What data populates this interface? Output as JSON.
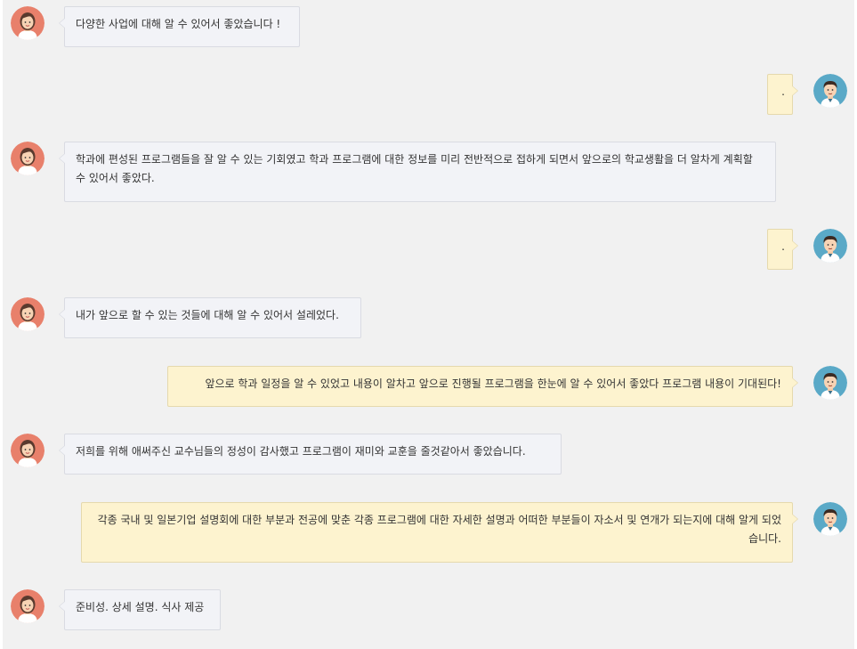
{
  "colors": {
    "left_bubble_bg": "#f2f3f7",
    "right_bubble_bg": "#fdf3cf",
    "chat_bg": "#f1f1f1",
    "female_avatar_bg": "#e8806b",
    "male_avatar_bg": "#5aa9c7"
  },
  "messages": [
    {
      "side": "left",
      "avatar": "female-avatar-icon",
      "text": "다양한 사업에 대해 알 수 있어서 좋았습니다 !"
    },
    {
      "side": "right",
      "avatar": "male-avatar-icon",
      "text": "."
    },
    {
      "side": "left",
      "avatar": "female-avatar-icon",
      "text": "학과에 편성된 프로그램들을 잘 알 수 있는 기회였고 학과 프로그램에 대한 정보를 미리 전반적으로 접하게 되면서 앞으로의 학교생활을 더 알차게 계획할 수 있어서 좋았다."
    },
    {
      "side": "right",
      "avatar": "male-avatar-icon",
      "text": "."
    },
    {
      "side": "left",
      "avatar": "female-avatar-icon",
      "text": "내가 앞으로 할 수 있는 것들에 대해 알 수 있어서 설레었다."
    },
    {
      "side": "right",
      "avatar": "male-avatar-icon",
      "text": "앞으로 학과 일정을 알 수 있었고 내용이 알차고 앞으로 진행될 프로그램을 한눈에 알 수 있어서 좋았다 프로그램 내용이 기대된다!"
    },
    {
      "side": "left",
      "avatar": "female-avatar-icon",
      "text": "저희를 위해 애써주신 교수님들의 정성이 감사했고 프로그램이 재미와 교훈을 줄것같아서 좋았습니다."
    },
    {
      "side": "right",
      "avatar": "male-avatar-icon",
      "text": "각종 국내 및 일본기업 설명회에 대한 부분과 전공에 맞춘 각종 프로그램에 대한 자세한 설명과 어떠한 부분들이 자소서 및 연개가 되는지에 대해 알게 되었습니다."
    },
    {
      "side": "left",
      "avatar": "female-avatar-icon",
      "text": "준비성. 상세 설명. 식사 제공"
    }
  ]
}
